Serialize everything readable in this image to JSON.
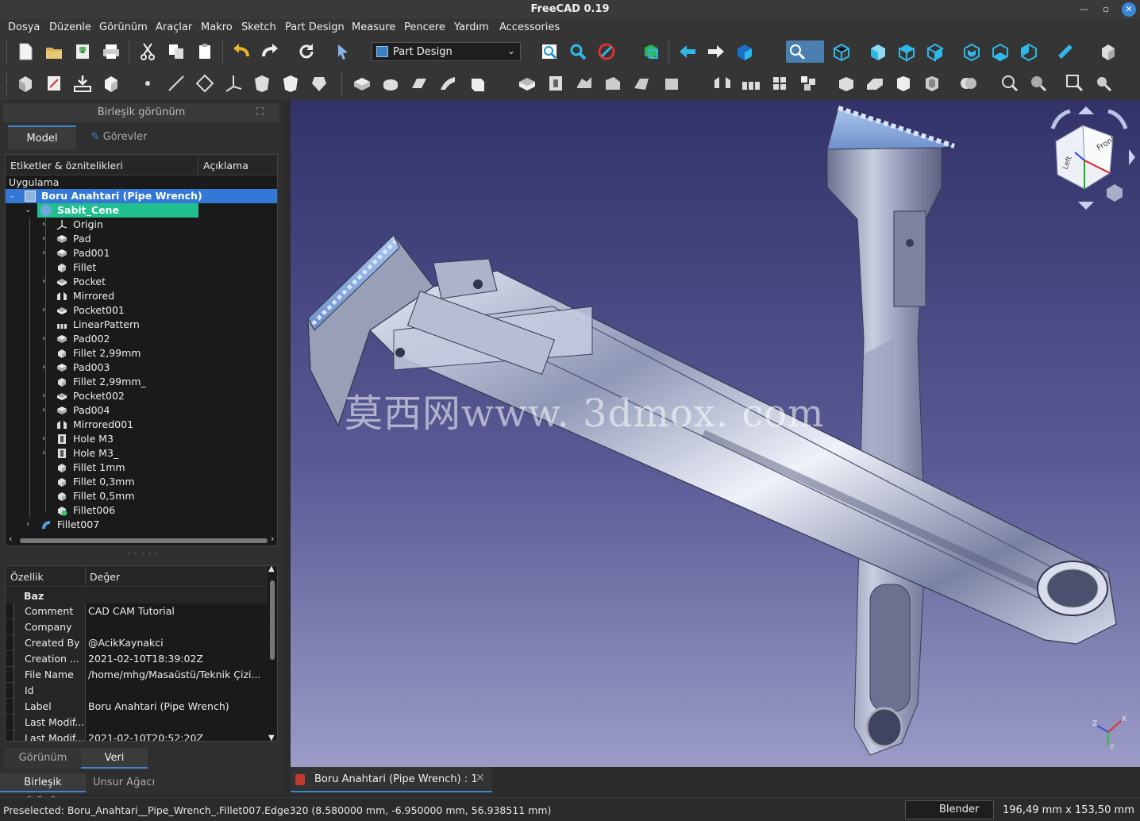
{
  "window": {
    "title": "FreeCAD 0.19"
  },
  "menu": [
    "Dosya",
    "Düzenle",
    "Görünüm",
    "Araçlar",
    "Makro",
    "Sketch",
    "Part Design",
    "Measure",
    "Pencere",
    "Yardım",
    "Accessories"
  ],
  "workbench": {
    "selected": "Part Design"
  },
  "combo_view": {
    "title": "Birleşik görünüm",
    "tabs": [
      "Model",
      "Görevler"
    ],
    "tree": {
      "col_labels": "Etiketler & öznitelikleri",
      "col_desc": "Açıklama",
      "app_label": "Uygulama",
      "document": "Boru Anahtari (Pipe Wrench)",
      "body": "Sabit_Cene",
      "features": [
        {
          "label": "Origin",
          "icon": "origin-icon",
          "expandable": true
        },
        {
          "label": "Pad",
          "icon": "pad-icon",
          "expandable": true
        },
        {
          "label": "Pad001",
          "icon": "pad-icon",
          "expandable": true
        },
        {
          "label": "Fillet",
          "icon": "fillet-icon",
          "expandable": false
        },
        {
          "label": "Pocket",
          "icon": "pocket-icon",
          "expandable": true
        },
        {
          "label": "Mirrored",
          "icon": "mirrored-icon",
          "expandable": false
        },
        {
          "label": "Pocket001",
          "icon": "pocket-icon",
          "expandable": true
        },
        {
          "label": "LinearPattern",
          "icon": "linear-pattern-icon",
          "expandable": false
        },
        {
          "label": "Pad002",
          "icon": "pad-icon",
          "expandable": true
        },
        {
          "label": "Fillet 2,99mm",
          "icon": "fillet-icon",
          "expandable": false
        },
        {
          "label": "Pad003",
          "icon": "pad-icon",
          "expandable": true
        },
        {
          "label": "Fillet 2,99mm_",
          "icon": "fillet-icon",
          "expandable": false
        },
        {
          "label": "Pocket002",
          "icon": "pocket-icon",
          "expandable": true
        },
        {
          "label": "Pad004",
          "icon": "pad-icon",
          "expandable": true
        },
        {
          "label": "Mirrored001",
          "icon": "mirrored-icon",
          "expandable": false
        },
        {
          "label": "Hole M3",
          "icon": "hole-icon",
          "expandable": true
        },
        {
          "label": "Hole M3_",
          "icon": "hole-icon",
          "expandable": true
        },
        {
          "label": "Fillet 1mm",
          "icon": "fillet-icon",
          "expandable": false
        },
        {
          "label": "Fillet 0,3mm",
          "icon": "fillet-icon",
          "expandable": false
        },
        {
          "label": "Fillet 0,5mm",
          "icon": "fillet-icon",
          "expandable": false
        },
        {
          "label": "Fillet006",
          "icon": "fillet-tip-icon",
          "expandable": false
        }
      ],
      "sibling": "Fillet007"
    }
  },
  "property_view": {
    "col_property": "Özellik",
    "col_value": "Değer",
    "group": "Baz",
    "rows": [
      {
        "name": "Comment",
        "value": "CAD CAM Tutorial"
      },
      {
        "name": "Company",
        "value": ""
      },
      {
        "name": "Created By",
        "value": "@AcikKaynakci"
      },
      {
        "name": "Creation ...",
        "value": "2021-02-10T18:39:02Z"
      },
      {
        "name": "File Name",
        "value": "/home/mhg/Masaüstü/Teknik Çizi..."
      },
      {
        "name": "Id",
        "value": ""
      },
      {
        "name": "Label",
        "value": "Boru Anahtari (Pipe Wrench)"
      },
      {
        "name": "Last Modif...",
        "value": ""
      },
      {
        "name": "Last Modif...",
        "value": "2021-02-10T20:52:20Z"
      }
    ],
    "tabs": [
      "Görünüm",
      "Veri"
    ]
  },
  "panel_tabs": [
    "Birleşik görünüm",
    "Unsur Ağacı"
  ],
  "viewport": {
    "watermark": "莫西网www. 3dmox. com",
    "navcube_face": "Front",
    "navcube_side": "Left",
    "axis_labels": {
      "x": "X",
      "y": "Y",
      "z": "Z"
    }
  },
  "document_tab": "Boru Anahtari (Pipe Wrench) : 1",
  "statusbar": {
    "message": "Preselected: Boru_Anahtari__Pipe_Wrench_.Fillet007.Edge320 (8.580000 mm, -6.950000 mm, 56.938511 mm)",
    "nav_style": "Blender",
    "dimensions": "196,49 mm x 153,50 mm"
  },
  "colors": {
    "accent": "#3d86d6",
    "selection_doc": "#3478d6",
    "selection_body": "#1fbf8f",
    "toolbar_icon": "#2fb8e8"
  }
}
